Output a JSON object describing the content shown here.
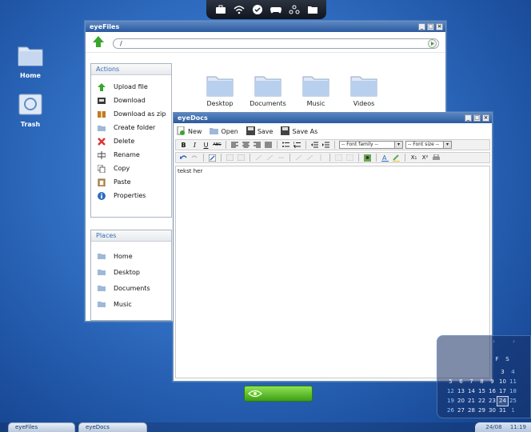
{
  "desktop": {
    "icons": [
      {
        "label": "Home",
        "icon": "folder-home-icon"
      },
      {
        "label": "Trash",
        "icon": "trash-icon"
      }
    ],
    "topbar_icons": [
      "briefcase-icon",
      "wifi-icon",
      "check-icon",
      "gamepad-icon",
      "people-icon",
      "folder-icon"
    ],
    "colors": {
      "desktop_bg": "#2f6cc0",
      "title_bar": "#3a68ab",
      "accent_green": "#5ac22c"
    }
  },
  "eyefiles": {
    "title": "eyeFiles",
    "path": "/",
    "actions_title": "Actions",
    "actions": [
      {
        "label": "Upload file",
        "icon": "upload-arrow-icon"
      },
      {
        "label": "Download",
        "icon": "download-icon"
      },
      {
        "label": "Download as zip",
        "icon": "zip-icon"
      },
      {
        "label": "Create folder",
        "icon": "new-folder-icon"
      },
      {
        "label": "Delete",
        "icon": "delete-x-icon"
      },
      {
        "label": "Rename",
        "icon": "rename-icon"
      },
      {
        "label": "Copy",
        "icon": "copy-icon"
      },
      {
        "label": "Paste",
        "icon": "paste-icon"
      },
      {
        "label": "Properties",
        "icon": "info-icon"
      }
    ],
    "places_title": "Places",
    "places": [
      {
        "label": "Home"
      },
      {
        "label": "Desktop"
      },
      {
        "label": "Documents"
      },
      {
        "label": "Music"
      }
    ],
    "folders": [
      {
        "label": "Desktop"
      },
      {
        "label": "Documents"
      },
      {
        "label": "Music"
      },
      {
        "label": "Videos"
      }
    ]
  },
  "eyedocs": {
    "title": "eyeDocs",
    "menu": {
      "new": "New",
      "open": "Open",
      "save": "Save",
      "save_as": "Save As"
    },
    "toolbar": {
      "bold": "B",
      "italic": "I",
      "underline": "U",
      "strike": "ABC",
      "font_family": "-- Font family --",
      "font_size": "-- Font size --",
      "subscript": "X₁",
      "superscript": "X²"
    },
    "content": "tekst her"
  },
  "calendar": {
    "header_days": [
      "F",
      "S"
    ],
    "rows": [
      [
        "",
        "",
        "",
        "",
        "",
        "",
        ""
      ],
      [
        "",
        "",
        "",
        "",
        "",
        "3",
        "4"
      ],
      [
        "5",
        "6",
        "7",
        "8",
        "9",
        "10",
        "11"
      ],
      [
        "12",
        "13",
        "14",
        "15",
        "16",
        "17",
        "18"
      ],
      [
        "19",
        "20",
        "21",
        "22",
        "23",
        "24",
        "25"
      ],
      [
        "26",
        "27",
        "28",
        "29",
        "30",
        "31",
        "1"
      ]
    ],
    "today": "24"
  },
  "taskbar": {
    "tasks": [
      {
        "label": "eyeFiles"
      },
      {
        "label": "eyeDocs"
      }
    ],
    "clock_date": "24/08",
    "clock_time": "11:19"
  }
}
